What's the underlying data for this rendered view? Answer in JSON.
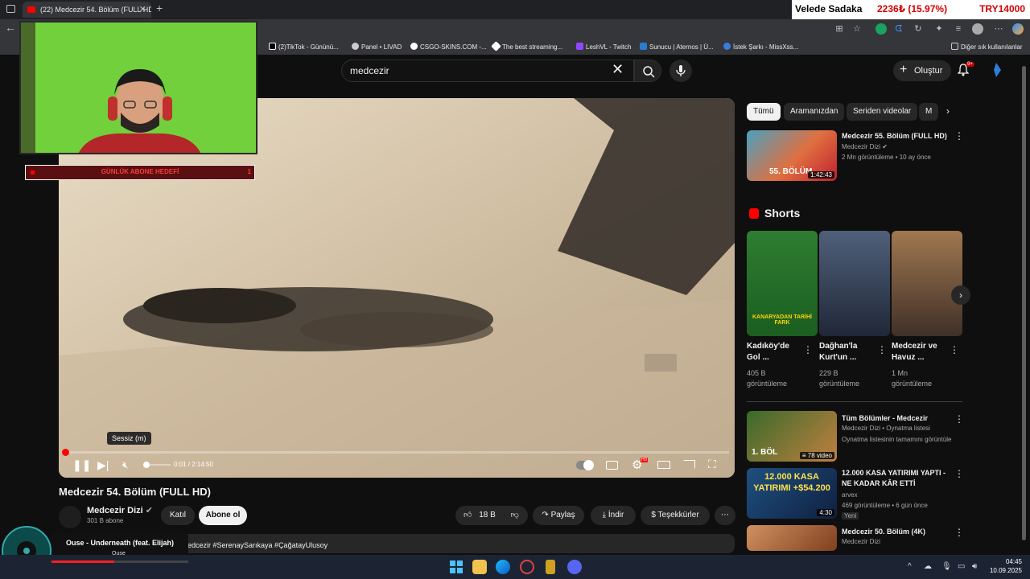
{
  "browser": {
    "tab_title": "(22) Medcezir 54. Bölüm (FULL HD)",
    "new_tab_symbol": "+",
    "bookmarks": [
      "(2)TikTok - Gününü...",
      "Panel • LIVAD",
      "CSGO-SKINS.COM -...",
      "The best streaming...",
      "LeshVL - Twitch",
      "Sunucu | Aternos | Ü...",
      "İstek Şarkı - MissXss..."
    ],
    "other_bookmarks": "Diğer sık kullanılanlar"
  },
  "donation_bar": {
    "name": "Velede Sadaka",
    "amount": "2236₺ (15.97%)",
    "goal": "TRY14000",
    "accent": "#d40000"
  },
  "stream_overlay": {
    "goal_label": "GÜNLÜK ABONE HEDEFİ",
    "goal_count": "1"
  },
  "youtube": {
    "search_value": "medcezir",
    "create_label": "Oluştur",
    "notification_badge": "9+"
  },
  "player": {
    "tooltip": "Sessiz (m)",
    "time": "0:01 / 2:14:50",
    "hd_badge": "HD",
    "progress_fraction": 0.0001
  },
  "video": {
    "title": "Medcezir 54. Bölüm (FULL HD)",
    "channel": "Medcezir Dizi",
    "subscribers": "301 B abone",
    "join_label": "Katıl",
    "subscribe_label": "Abone ol",
    "likes": "18 B",
    "share_label": "Paylaş",
    "download_label": "İndir",
    "thanks_label": "Teşekkürler",
    "description_preview": "edcezir #SerenaySarıkaya #ÇağatayUlusoy"
  },
  "filters": [
    "Tümü",
    "Aramanızdan",
    "Seriden videolar",
    "M"
  ],
  "recommendations": [
    {
      "title": "Medcezir 55. Bölüm (FULL HD)",
      "channel": "Medcezir Dizi",
      "meta": "2 Mn görüntüleme • 10 ay önce",
      "duration": "1:42:43",
      "thumb_text": "55. BÖLÜM"
    }
  ],
  "shorts": {
    "heading": "Shorts",
    "items": [
      {
        "title": "Kadıköy'de Gol ...",
        "views": "405 B görüntüleme",
        "thumb_text": "KANARYADAN TARİHİ FARK"
      },
      {
        "title": "Dağhan'la Kurt'un ...",
        "views": "229 B görüntüleme"
      },
      {
        "title": "Medcezir ve Havuz ...",
        "views": "1 Mn görüntüleme"
      }
    ]
  },
  "more_recommendations": [
    {
      "title": "Tüm Bölümler - Medcezir",
      "channel": "Medcezir Dizi • Oynatma listesi",
      "meta": "Oynatma listesinin tamamını görüntüle",
      "badge": "≡ 78 video",
      "thumb_text": "1. BÖL"
    },
    {
      "title": "12.000 KASA YATIRIMI YAPTI - NE KADAR KÂR ETTİ",
      "channel": "arvex",
      "meta": "469 görüntüleme • 6 gün önce",
      "new_badge": "Yeni",
      "duration": "4:30",
      "thumb_text": "12.000 KASA YATIRIMI +$54.200"
    },
    {
      "title": "Medcezir 50. Bölüm (4K)",
      "channel": "Medcezir Dizi"
    }
  ],
  "music": {
    "song": "Ouse - Underneath (feat. Elijah)",
    "artist": "Ouse"
  },
  "taskbar": {
    "time": "04:45",
    "date": "10.09.2025"
  }
}
